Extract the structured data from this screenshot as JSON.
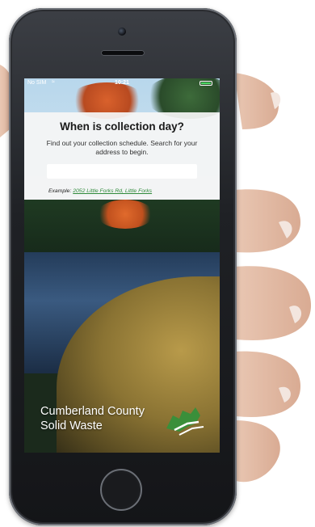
{
  "status_bar": {
    "carrier": "No SIM",
    "time": "10:21"
  },
  "colors": {
    "accent_link": "#2f8a3a",
    "battery": "#4cd964",
    "logo_green": "#3a8f3a"
  },
  "header": {
    "title": "When is collection day?",
    "description": "Find out your collection schedule. Search for your address to begin."
  },
  "search": {
    "value": "",
    "placeholder": ""
  },
  "example": {
    "prefix": "Example: ",
    "link": "2052 Little Forks Rd, Little Forks"
  },
  "brand": {
    "line1": "Cumberland County",
    "line2": "Solid Waste",
    "logo_icon": "county-map-logo"
  }
}
